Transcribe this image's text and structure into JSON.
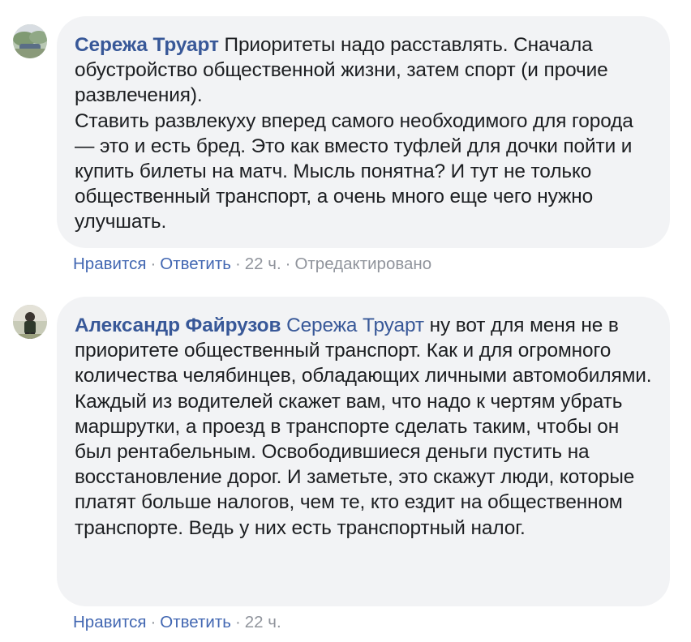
{
  "comments": [
    {
      "author": "Сережа Труарт",
      "text_first": " Приоритеты надо расставлять. Сначала обустройство общественной жизни, затем спорт (и прочие развлечения).",
      "text_second": "Ставить развлекуху вперед самого необходимого для города — это и есть бред. Это как вместо туфлей для дочки пойти и купить билеты на матч. Мысль понятна? И тут не только общественный транспорт, а очень много еще чего нужно улучшать.",
      "like_label": "Нравится",
      "reply_label": "Ответить",
      "time": "22 ч.",
      "edited": "Отредактировано",
      "separator": "·"
    },
    {
      "author": "Александр Файрузов",
      "mention": "Сережа Труарт",
      "text": " ну вот для меня не в приоритете общественный транспорт. Как и для огромного количества челябинцев, обладающих личными автомобилями. Каждый из водителей скажет вам, что надо к чертям убрать маршрутки, а проезд в транспорте сделать таким, чтобы он был рентабельным. Освободившиеся деньги пустить на восстановление дорог. И заметьте, это скажут люди, которые платят больше налогов, чем те, кто ездит на общественном транспорте. Ведь у них есть транспортный налог.",
      "like_label": "Нравится",
      "reply_label": "Ответить",
      "time": "22 ч.",
      "separator": "·"
    }
  ],
  "colors": {
    "bubble_bg": "#f2f3f5",
    "author": "#385898",
    "action_link": "#4267b2",
    "meta": "#90949c",
    "text": "#1c1e21"
  }
}
